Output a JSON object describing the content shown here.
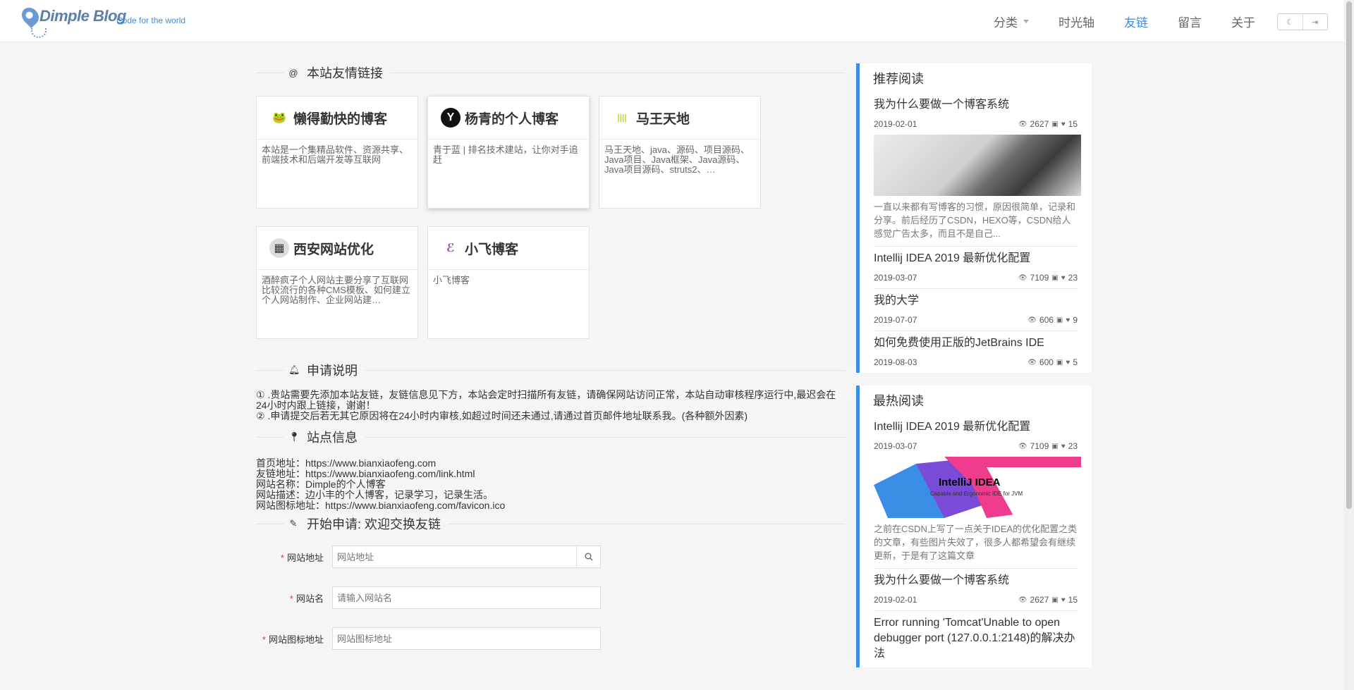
{
  "header": {
    "logo_text": "Dimple Blog",
    "slogan": "Code for the world",
    "nav": [
      {
        "label": "分类",
        "has_dropdown": true
      },
      {
        "label": "时光轴"
      },
      {
        "label": "友链",
        "active": true
      },
      {
        "label": "留言"
      },
      {
        "label": "关于"
      }
    ],
    "toggles": {
      "dark_icon": "moon-icon",
      "login_icon": "login-icon"
    }
  },
  "links_section": {
    "title": "本站友情链接",
    "cards": [
      {
        "name": "懒得勤快的博客",
        "desc": "本站是一个集精品软件、资源共享、前端技术和后端开发等互联网",
        "icon_glyph": "🐸",
        "icon_bg": "#fff"
      },
      {
        "name": "杨青的个人博客",
        "desc": "青于蓝 | 排名技术建站，让你对手追赶",
        "icon_glyph": "Y",
        "icon_bg": "#111"
      },
      {
        "name": "马王天地",
        "desc": "马王天地、java、源码、项目源码、Java项目、Java框架、Java源码、Java项目源码、struts2、…",
        "icon_glyph": "||||",
        "icon_bg": "#fff"
      },
      {
        "name": "西安网站优化",
        "desc": "酒醉疯子个人网站主要分享了互联网比较流行的各种CMS模板、如何建立个人网站制作、企业网站建…",
        "icon_glyph": "▦",
        "icon_bg": "#ddd"
      },
      {
        "name": "小飞博客",
        "desc": "小飞博客",
        "icon_glyph": "ℰ",
        "icon_bg": "#fff"
      }
    ]
  },
  "apply_notes": {
    "title": "申请说明",
    "lines": [
      "① .贵站需要先添加本站友链，友链信息见下方，本站会定时扫描所有友链，请确保网站访问正常，本站自动审核程序运行中,最迟会在24小时内跟上链接，谢谢！",
      "② .申请提交后若无其它原因将在24小时内审核,如超过时间还未通过,请通过首页邮件地址联系我。(各种额外因素)"
    ]
  },
  "site_info": {
    "title": "站点信息",
    "lines": [
      "首页地址：https://www.bianxiaofeng.com",
      "友链地址：https://www.bianxiaofeng.com/link.html",
      "网站名称：Dimple的个人博客",
      "网站描述：边小丰的个人博客，记录学习，记录生活。",
      "网站图标地址：https://www.bianxiaofeng.com/favicon.ico"
    ]
  },
  "apply_form": {
    "title": "开始申请: 欢迎交换友链",
    "fields": [
      {
        "label": "网站地址",
        "placeholder": "网站地址"
      },
      {
        "label": "网站名",
        "placeholder": "请输入网站名"
      },
      {
        "label": "网站图标地址",
        "placeholder": "网站图标地址"
      }
    ]
  },
  "sidebar": {
    "recommended": {
      "title": "推荐阅读",
      "posts": [
        {
          "title": "我为什么要做一个博客系统",
          "date": "2019-02-01",
          "views": "2627",
          "likes": "15",
          "image": "desk",
          "excerpt": "一直以来都有写博客的习惯，原因很简单，记录和分享。前后经历了CSDN，HEXO等，CSDN给人感觉广告太多，而且不是自己..."
        },
        {
          "title": "Intellij IDEA 2019 最新优化配置",
          "date": "2019-03-07",
          "views": "7109",
          "likes": "23"
        },
        {
          "title": "我的大学",
          "date": "2019-07-07",
          "views": "606",
          "likes": "9"
        },
        {
          "title": "如何免费使用正版的JetBrains IDE",
          "date": "2019-08-03",
          "views": "600",
          "likes": "5"
        }
      ]
    },
    "hottest": {
      "title": "最热阅读",
      "posts": [
        {
          "title": "Intellij IDEA 2019 最新优化配置",
          "date": "2019-03-07",
          "views": "7109",
          "likes": "23",
          "image": "idea",
          "image_caption": "IntelliJ IDEA",
          "image_subcaption": "Capable and Ergonomic IDE for JVM",
          "excerpt": "之前在CSDN上写了一点关于IDEA的优化配置之类的文章，有些图片失效了，很多人都希望会有继续更新，于是有了这篇文章"
        },
        {
          "title": "我为什么要做一个博客系统",
          "date": "2019-02-01",
          "views": "2627",
          "likes": "15"
        },
        {
          "title": "Error running 'Tomcat'Unable to open debugger port (127.0.0.1:2148)的解决办法"
        }
      ]
    }
  }
}
